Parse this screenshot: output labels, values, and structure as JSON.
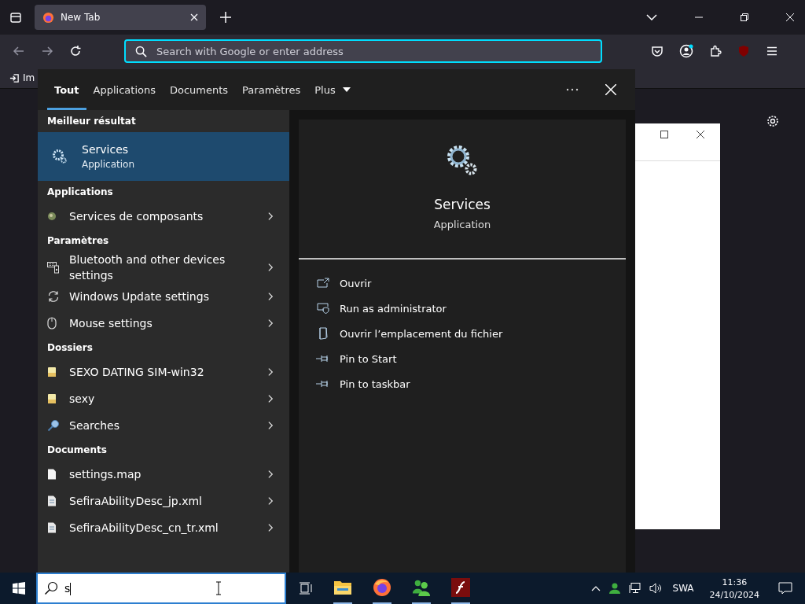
{
  "browser": {
    "tab": {
      "title": "New Tab"
    },
    "address": {
      "placeholder": "Search with Google or enter address"
    },
    "bookmark": "Im"
  },
  "search_panel": {
    "tabs": [
      {
        "label": "Tout",
        "selected": true
      },
      {
        "label": "Applications",
        "selected": false
      },
      {
        "label": "Documents",
        "selected": false
      },
      {
        "label": "Paramètres",
        "selected": false
      },
      {
        "label": "Plus",
        "selected": false
      }
    ],
    "best_header": "Meilleur résultat",
    "best": {
      "title": "Services",
      "subtitle": "Application"
    },
    "sections": [
      {
        "header": "Applications",
        "items": [
          {
            "label": "Services de composants",
            "kind": "component"
          }
        ]
      },
      {
        "header": "Paramètres",
        "items": [
          {
            "label": "Bluetooth and other devices settings",
            "kind": "devices"
          },
          {
            "label": "Windows Update settings",
            "kind": "sync"
          },
          {
            "label": "Mouse settings",
            "kind": "mouse"
          }
        ]
      },
      {
        "header": "Dossiers",
        "items": [
          {
            "label": "SEXO DATING SIM-win32",
            "kind": "folder"
          },
          {
            "label": "sexy",
            "kind": "folder"
          },
          {
            "label": "Searches",
            "kind": "magnifier"
          }
        ]
      },
      {
        "header": "Documents",
        "items": [
          {
            "label": "settings.map",
            "kind": "file"
          },
          {
            "label": "SefiraAbilityDesc_jp.xml",
            "kind": "xml"
          },
          {
            "label": "SefiraAbilityDesc_cn_tr.xml",
            "kind": "xml"
          }
        ]
      }
    ],
    "detail": {
      "title": "Services",
      "subtitle": "Application",
      "actions": [
        {
          "label": "Ouvrir",
          "kind": "open"
        },
        {
          "label": "Run as administrator",
          "kind": "admin"
        },
        {
          "label": "Ouvrir l’emplacement du fichier",
          "kind": "location"
        },
        {
          "label": "Pin to Start",
          "kind": "pin"
        },
        {
          "label": "Pin to taskbar",
          "kind": "pin"
        }
      ]
    }
  },
  "taskbar": {
    "search_value": "s",
    "language": "SWA",
    "time": "11:36",
    "date": "24/10/2024"
  }
}
